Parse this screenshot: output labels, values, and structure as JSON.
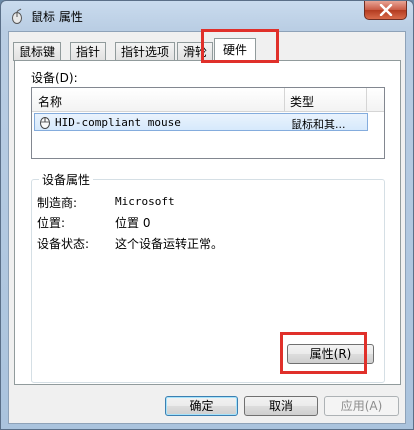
{
  "window": {
    "title": "鼠标 属性"
  },
  "tabs": [
    {
      "label": "鼠标键"
    },
    {
      "label": "指针"
    },
    {
      "label": "指针选项"
    },
    {
      "label": "滑轮"
    },
    {
      "label": "硬件"
    }
  ],
  "devices": {
    "label": "设备(D):",
    "columns": [
      "名称",
      "类型"
    ],
    "rows": [
      {
        "name": "HID-compliant mouse",
        "type": "鼠标和其..."
      }
    ]
  },
  "device_properties": {
    "title": "设备属性",
    "manufacturer_label": "制造商:",
    "manufacturer_value": "Microsoft",
    "location_label": "位置:",
    "location_value": "位置 0",
    "status_label": "设备状态:",
    "status_value": "这个设备运转正常。",
    "properties_button": "属性(R)"
  },
  "footer": {
    "ok": "确定",
    "cancel": "取消",
    "apply": "应用(A)"
  },
  "colors": {
    "highlight": "#e0302a",
    "selection": "#d6e9fc"
  }
}
